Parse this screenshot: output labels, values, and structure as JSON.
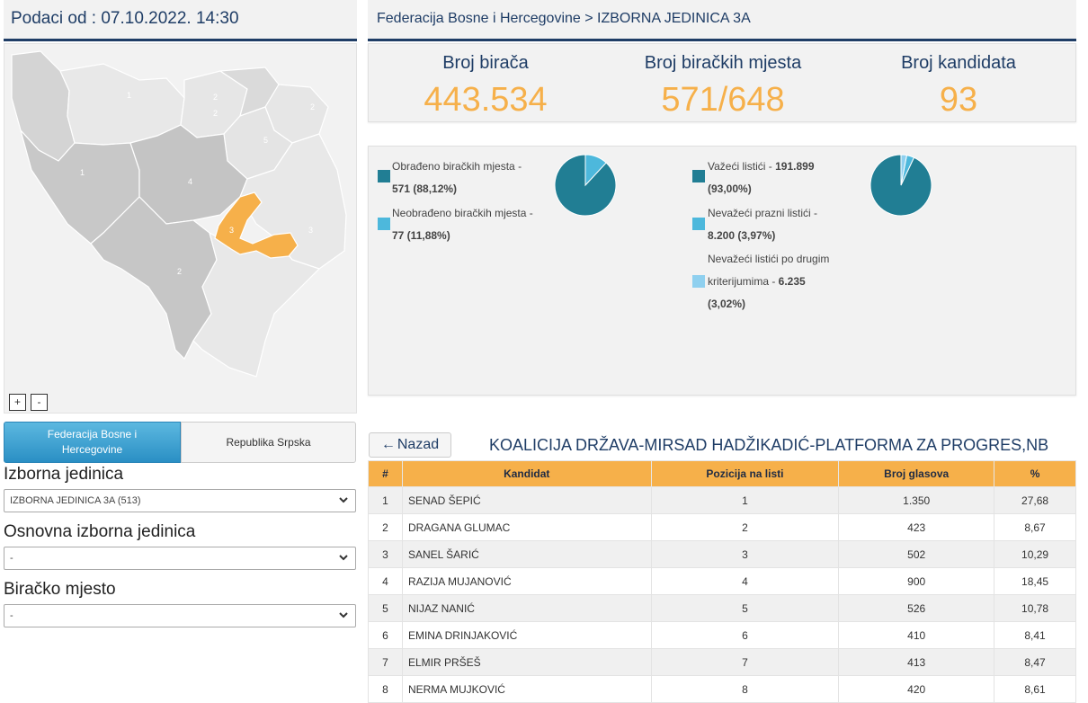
{
  "left_header": {
    "timestamp": "Podaci od : 07.10.2022. 14:30"
  },
  "map": {
    "region_labels": [
      "1",
      "2",
      "2",
      "5",
      "2",
      "1",
      "4",
      "3",
      "3",
      "2"
    ],
    "highlight_color": "#f6b04a",
    "zoom_in_label": "+",
    "zoom_out_label": "-"
  },
  "entity_tabs": {
    "fbih": "Federacija Bosne i Hercegovine",
    "rs": "Republika Srpska"
  },
  "filters": {
    "unit_label": "Izborna jedinica",
    "unit_value": "IZBORNA JEDINICA 3A (513)",
    "basic_unit_label": "Osnovna izborna jedinica",
    "basic_unit_value": "-",
    "polling_label": "Biračko mjesto",
    "polling_value": "-"
  },
  "breadcrumb": "Federacija Bosne i Hercegovine > IZBORNA JEDINICA 3A",
  "stats": {
    "voters_label": "Broj birača",
    "voters_value": "443.534",
    "stations_label": "Broj biračkih mjesta",
    "stations_value": "571/648",
    "candidates_label": "Broj kandidata",
    "candidates_value": "93"
  },
  "processing_chart": {
    "processed_label": "Obrađeno biračkih mjesta - ",
    "processed_value": "571 (88,12%)",
    "processed_pct": 88.12,
    "unprocessed_label": "Neobrađeno biračkih mjesta - ",
    "unprocessed_value": "77 (11,88%)",
    "unprocessed_pct": 11.88,
    "colors": [
      "#217e94",
      "#4db8dc"
    ]
  },
  "ballots_chart": {
    "valid_label": "Važeći listići - ",
    "valid_value": "191.899",
    "valid_pct_text": "(93,00%)",
    "valid_pct": 93.0,
    "blank_label": "Nevažeći prazni listići - ",
    "blank_value": "8.200 (3,97%)",
    "blank_pct": 3.97,
    "other_label_1": "Nevažeći listići po drugim",
    "other_label_2": "kriterijumima - ",
    "other_value": "6.235",
    "other_pct_text": "(3,02%)",
    "other_pct": 3.02,
    "colors": [
      "#217e94",
      "#4db8dc",
      "#8fd0ef"
    ]
  },
  "back_button": {
    "arrow": "←",
    "label": "Nazad"
  },
  "list_title": "KOALICIJA DRŽAVA-MIRSAD HADŽIKADIĆ-PLATFORMA ZA PROGRES,NB",
  "table": {
    "headers": [
      "#",
      "Kandidat",
      "Pozicija na listi",
      "Broj glasova",
      "%"
    ],
    "rows": [
      [
        "1",
        "SENAD ŠEPIĆ",
        "1",
        "1.350",
        "27,68"
      ],
      [
        "2",
        "DRAGANA GLUMAC",
        "2",
        "423",
        "8,67"
      ],
      [
        "3",
        "SANEL ŠARIĆ",
        "3",
        "502",
        "10,29"
      ],
      [
        "4",
        "RAZIJA MUJANOVIĆ",
        "4",
        "900",
        "18,45"
      ],
      [
        "5",
        "NIJAZ NANIĆ",
        "5",
        "526",
        "10,78"
      ],
      [
        "6",
        "EMINA DRINJAKOVIĆ",
        "6",
        "410",
        "8,41"
      ],
      [
        "7",
        "ELMIR PRŠEŠ",
        "7",
        "413",
        "8,47"
      ],
      [
        "8",
        "NERMA MUJKOVIĆ",
        "8",
        "420",
        "8,61"
      ]
    ]
  }
}
